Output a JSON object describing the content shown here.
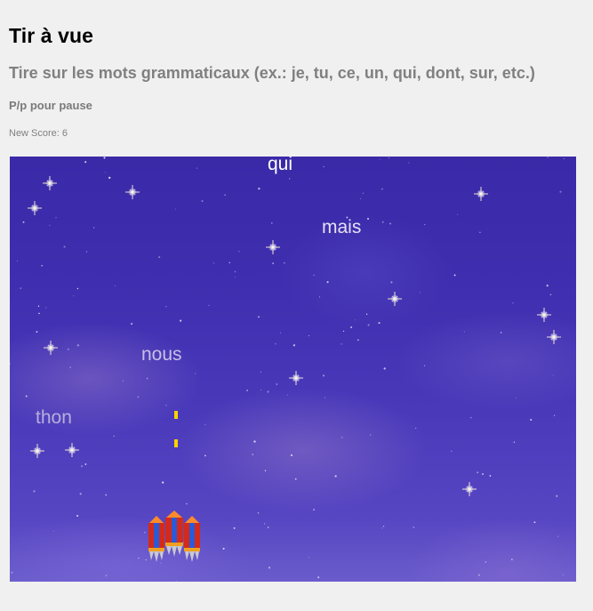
{
  "header": {
    "title": "Tir à vue",
    "subtitle": "Tire sur les mots grammaticaux (ex.: je, tu, ce, un, qui, dont, sur, etc.)",
    "pause_hint": "P/p pour pause",
    "score_label": "New Score: 6"
  },
  "game": {
    "words": {
      "qui": "qui",
      "mais": "mais",
      "nous": "nous",
      "thon": "thon"
    },
    "colors": {
      "bullet": "#ffd200",
      "ship_red": "#d42a1a",
      "ship_blue": "#2a5ad8"
    }
  }
}
